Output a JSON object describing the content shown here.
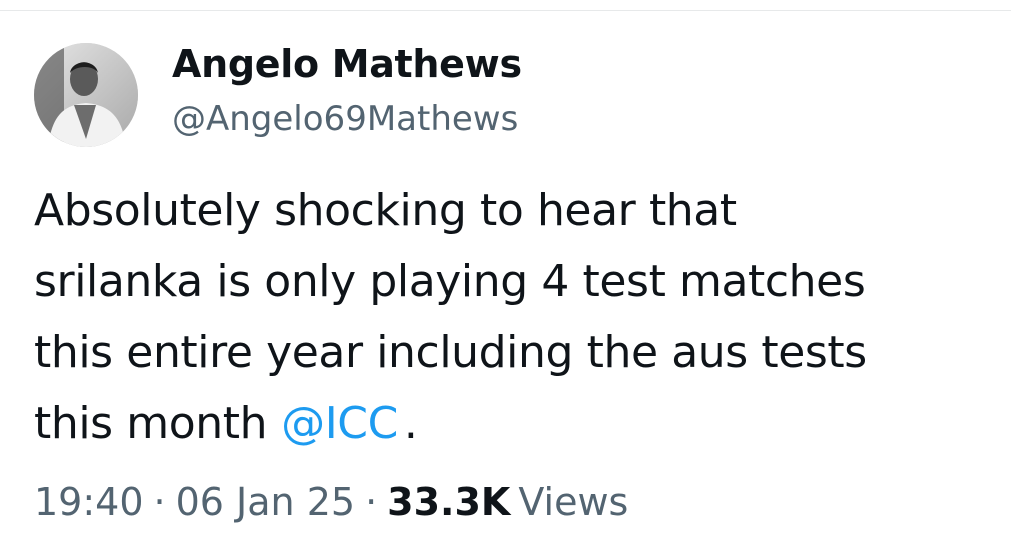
{
  "author": {
    "display_name": "Angelo Mathews",
    "handle": "@Angelo69Mathews"
  },
  "tweet": {
    "lines": [
      "Absolutely shocking to hear that",
      "srilanka is only playing 4 test matches",
      "this entire year including the aus tests"
    ],
    "last_line_text": "this month",
    "mention": "@ICC",
    "trailing": "."
  },
  "meta": {
    "time": "19:40",
    "date": "06 Jan 25",
    "separator": "·",
    "views_count": "33.3K",
    "views_label": "Views"
  },
  "colors": {
    "text": "#0f1419",
    "secondary": "#536471",
    "link": "#1d9bf0"
  }
}
